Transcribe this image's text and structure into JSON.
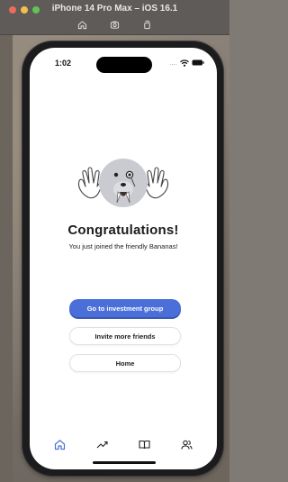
{
  "window": {
    "title": "iPhone 14 Pro Max – iOS 16.1",
    "toolbar_icons": [
      "home-icon",
      "screenshot-icon",
      "rotate-icon"
    ]
  },
  "status_bar": {
    "time": "1:02",
    "signal": "....",
    "icons": [
      "wifi-icon",
      "battery-icon"
    ]
  },
  "content": {
    "heading": "Congratulations!",
    "subtext": "You just joined the friendly Bananas!",
    "mascot": "walrus-mascot"
  },
  "buttons": {
    "primary": "Go to investment group",
    "invite": "Invite more friends",
    "home": "Home"
  },
  "tab_bar": {
    "tabs": [
      "home-icon",
      "trending-icon",
      "book-icon",
      "people-icon"
    ],
    "active": "home-icon"
  },
  "colors": {
    "primary": "#4a6fd8",
    "active_tab": "#4a6fd8",
    "inactive_tab": "#222222"
  }
}
